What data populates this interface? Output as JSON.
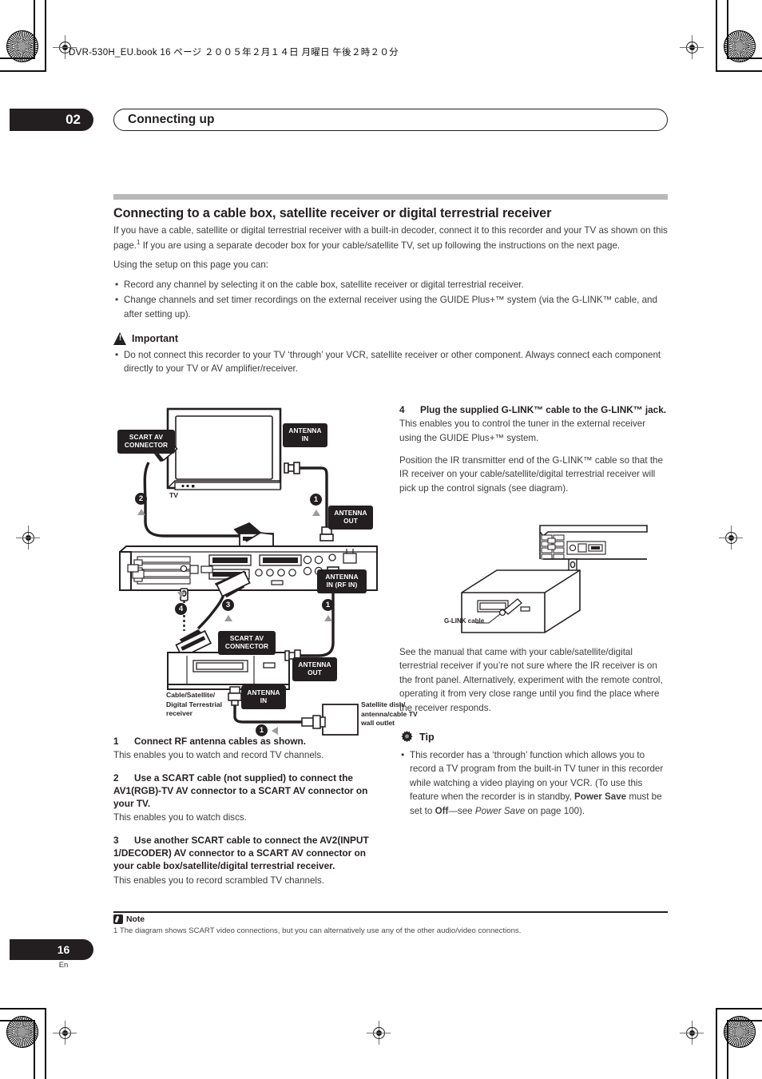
{
  "running_header": "DVR-530H_EU.book  16 ページ  ２００５年２月１４日  月曜日  午後２時２０分",
  "chapter": {
    "number": "02",
    "title": "Connecting up"
  },
  "section": {
    "heading": "Connecting to a cable box, satellite receiver or digital terrestrial receiver",
    "intro_1a": "If you have a cable, satellite or digital terrestrial receiver with a built-in decoder, connect it to this recorder and your TV as shown on this page.",
    "intro_1_sup": "1",
    "intro_1b": " If you are using a separate decoder box for your cable/satellite TV, set up following the instructions on the next page.",
    "intro_2": "Using the setup on this page you can:",
    "bullets": [
      "Record any channel by selecting it on the cable box, satellite receiver or digital terrestrial receiver.",
      "Change channels and set timer recordings on the external receiver using the GUIDE Plus+™ system (via the G-LINK™ cable, and after setting up)."
    ]
  },
  "important": {
    "icon": "warning-triangle-icon",
    "label": "Important",
    "bullets": [
      "Do not connect this recorder to your TV ‘through’ your VCR, satellite receiver or other component. Always connect each component directly to your TV or AV amplifier/receiver."
    ]
  },
  "diagram_main": {
    "labels": {
      "scart_av_connector_tv": "SCART AV\nCONNECTOR",
      "scart_av_connector_box": "SCART AV\nCONNECTOR",
      "antenna_in_tv": "ANTENNA\nIN",
      "antenna_out_recorder": "ANTENNA\nOUT",
      "antenna_in_rf_in": "ANTENNA\nIN (RF IN)",
      "antenna_out_box": "ANTENNA\nOUT",
      "antenna_in_box": "ANTENNA\nIN",
      "tv": "TV",
      "receiver_caption": "Cable/Satellite/\nDigital Terrestrial\nreceiver",
      "wall_outlet_caption": "Satellite dish/\nantenna/cable TV\nwall outlet"
    },
    "callouts": [
      "1",
      "2",
      "3",
      "4",
      "1",
      "1"
    ]
  },
  "steps_left": [
    {
      "n": "1",
      "title": "Connect RF antenna cables as shown.",
      "body": "This enables you to watch and record TV channels."
    },
    {
      "n": "2",
      "title": "Use a SCART cable (not supplied) to connect the AV1(RGB)-TV AV connector to a SCART AV connector on your TV.",
      "body": "This enables you to watch discs."
    },
    {
      "n": "3",
      "title": "Use another SCART cable to connect the AV2(INPUT 1/DECODER) AV connector to a SCART AV connector on your cable box/satellite/digital terrestrial receiver.",
      "body": "This enables you to record scrambled TV channels."
    }
  ],
  "step_right": {
    "n": "4",
    "title": "Plug the supplied G-LINK™ cable to the G-LINK™ jack.",
    "body_1": "This enables you to control the tuner in the external receiver using the GUIDE Plus+™ system.",
    "body_2": "Position the IR transmitter end of the G-LINK™ cable so that the IR receiver on your cable/satellite/digital terrestrial receiver will pick up the control signals (see diagram).",
    "body_3": "See the manual that came with your cable/satellite/digital terrestrial receiver if you’re not sure where the IR receiver is on the front panel. Alternatively, experiment with the remote control, operating it from very close range until you find the place where the receiver responds."
  },
  "diagram_glink": {
    "caption": "G-LINK cable"
  },
  "tip": {
    "icon": "gear-icon",
    "label": "Tip",
    "bullet_parts": {
      "a": "This recorder has a ‘through’ function which allows you to record a TV program from the built-in TV tuner in this recorder while watching a video playing on your VCR. (To use this feature when the recorder is in standby, ",
      "b_bold1": "Power Save",
      "c": " must be set to ",
      "d_bold2": "Off",
      "e": "—see ",
      "f_italic": "Power Save",
      "g": " on page 100)."
    }
  },
  "footer": {
    "note_icon": "note-pen-icon",
    "note_label": "Note",
    "note_text": "1 The diagram shows SCART video connections, but you can alternatively use any of the other audio/video connections.",
    "page_number": "16",
    "language": "En"
  },
  "colors": {
    "ink": "#231f20",
    "rule": "#b9b9b9",
    "body": "#3b3b3b",
    "arrow": "#9b9b9b"
  }
}
